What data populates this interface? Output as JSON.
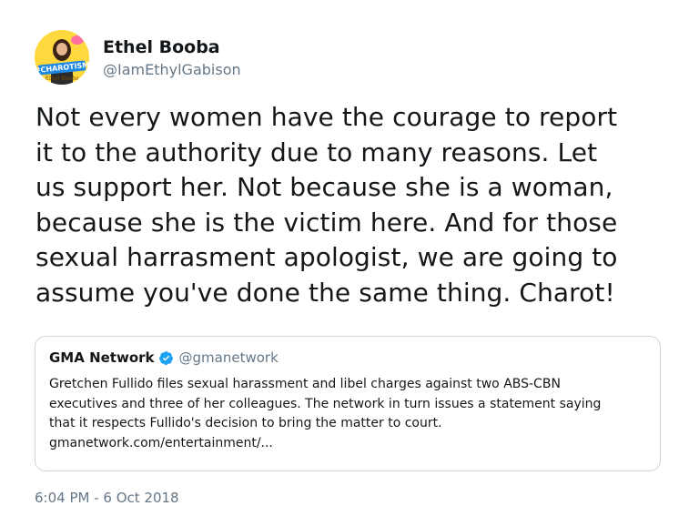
{
  "author": {
    "display_name": "Ethel Booba",
    "handle": "@IamEthylGabison",
    "avatar": {
      "icon": "avatar-charotism",
      "text": "#CHAROTISM",
      "signature": "Ethel Booba",
      "bg_color": "#ffd83d"
    }
  },
  "tweet": {
    "text_lines": [
      "Not every women have the courage to report",
      "it to the authority due to many reasons. Let",
      "us support her. Not because she is a woman,",
      "because she is the victim here. And for those",
      "sexual harrasment apologist, we are going to",
      "assume you've done the same thing. Charot!"
    ],
    "timestamp": "6:04 PM - 6 Oct 2018"
  },
  "quoted_tweet": {
    "display_name": "GMA Network",
    "verified_icon": "verified-badge-icon",
    "handle": "@gmanetwork",
    "text_lines": [
      "Gretchen Fullido files sexual harassment and libel charges against two ABS-CBN",
      "executives and three of her colleagues. The network in turn issues a statement saying",
      "that it respects Fullido's decision to bring the matter to court.",
      "gmanetwork.com/entertainment/..."
    ]
  },
  "colors": {
    "text_primary": "#14171a",
    "text_secondary": "#657786",
    "border": "#ccd6dd",
    "verified_blue": "#1da1f2"
  }
}
